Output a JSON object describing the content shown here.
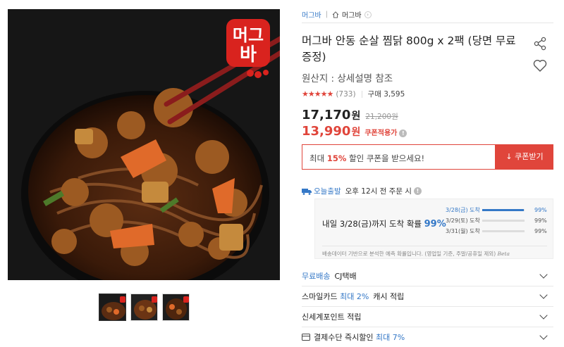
{
  "brand": {
    "logo_text": "머그",
    "logo_text2": "바"
  },
  "breadcrumb": {
    "brand": "머그바",
    "store": "머그바"
  },
  "product": {
    "title": "머그바 안동 순살 찜닭 800g x 2팩 (당면 무료 증정)",
    "origin": "원산지 : 상세설명 참조",
    "rating_stars": "★★★★★",
    "review_count": "(733)",
    "purchase_count": "구매 3,595"
  },
  "price": {
    "sale": "17,170",
    "won": "원",
    "original": "21,200원",
    "coupon_price": "13,990",
    "coupon_label": "쿠폰적용가",
    "info": "!"
  },
  "coupon": {
    "prefix": "최대 ",
    "pct": "15%",
    "suffix": " 할인 쿠폰을 받으세요!",
    "button": "↓ 쿠폰받기"
  },
  "delivery": {
    "today_label": "오늘출발",
    "today_text": "오후 12시 전 주문 시",
    "arrival_text": "내일 3/28(금)까지 도착 확률 ",
    "arrival_pct": "99%",
    "probabilities": [
      {
        "date": "3/28(금) 도착",
        "pct": "99%",
        "fill": 0.99
      },
      {
        "date": "3/29(토) 도착",
        "pct": "99%",
        "fill": 0.0
      },
      {
        "date": "3/31(월) 도착",
        "pct": "99%",
        "fill": 0.0
      }
    ],
    "note": "배송데이터 기반으로 분석한 예측 확률입니다. (영업일 기준, 주말/공휴일 제외)",
    "beta": "Beta"
  },
  "accordion": [
    {
      "blue": "무료배송",
      "text": "CJ택배"
    },
    {
      "text_pre": "스마일카드 ",
      "blue": "최대 2%",
      "text": " 캐시 적립"
    },
    {
      "text": "신세계포인트 적립"
    },
    {
      "text_pre": "결제수단 즉시할인 ",
      "blue": "최대 7%"
    }
  ],
  "colors": {
    "accent_red": "#e0453b",
    "accent_blue": "#3478c7"
  }
}
